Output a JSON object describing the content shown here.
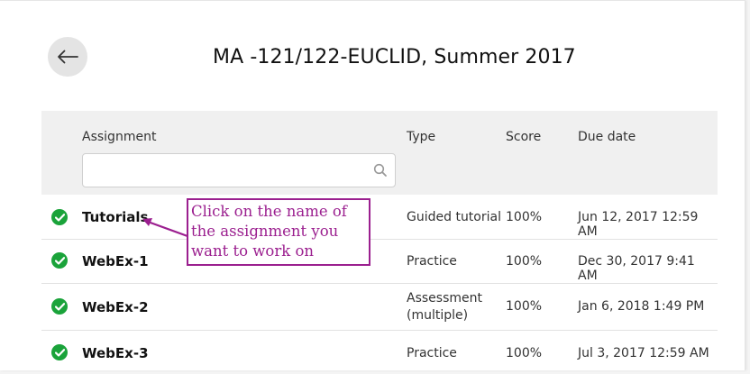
{
  "page": {
    "title": "MA -121/122-EUCLID, Summer 2017",
    "back_label": "Back"
  },
  "table": {
    "headers": {
      "assignment": "Assignment",
      "type": "Type",
      "score": "Score",
      "due_date": "Due date"
    },
    "search": {
      "value": "",
      "placeholder": ""
    },
    "rows": [
      {
        "name": "Tutorials",
        "type": "Guided tutorial",
        "type_line2": "",
        "score": "100%",
        "due": "Jun 12, 2017 12:59 AM",
        "status": "complete"
      },
      {
        "name": "WebEx-1",
        "type": "Practice",
        "type_line2": "",
        "score": "100%",
        "due": "Dec 30, 2017 9:41 AM",
        "status": "complete"
      },
      {
        "name": "WebEx-2",
        "type": "Assessment",
        "type_line2": "(multiple)",
        "score": "100%",
        "due": "Jan 6, 2018 1:49 PM",
        "status": "complete"
      },
      {
        "name": "WebEx-3",
        "type": "Practice",
        "type_line2": "",
        "score": "100%",
        "due": "Jul 3, 2017 12:59 AM",
        "status": "complete"
      }
    ]
  },
  "annotation": {
    "lines": [
      "Click on the name of",
      "the assignment you",
      "want to work on"
    ],
    "color": "#9b1f8f"
  },
  "colors": {
    "check_green": "#1aa33a",
    "header_bg": "#f0f0f0"
  },
  "icons": {
    "back": "arrow-left-icon",
    "search": "search-icon",
    "status": "check-circle-icon"
  }
}
